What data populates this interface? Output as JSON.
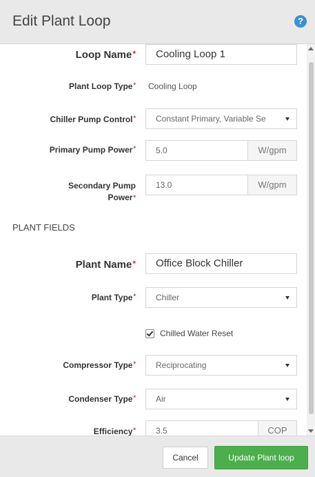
{
  "header": {
    "title": "Edit Plant Loop",
    "help_icon": "question-circle-icon"
  },
  "loop": {
    "name_label": "Loop Name",
    "name_value": "Cooling Loop 1",
    "type_label": "Plant Loop Type",
    "type_value": "Cooling Loop",
    "pump_control_label": "Chiller Pump Control",
    "pump_control_value": "Constant Primary, Variable Se",
    "primary_power_label": "Primary Pump Power",
    "primary_power_value": "5.0",
    "primary_power_unit": "W/gpm",
    "secondary_power_label_1": "Secondary Pump",
    "secondary_power_label_2": "Power",
    "secondary_power_value": "13.0",
    "secondary_power_unit": "W/gpm"
  },
  "plant": {
    "section_title": "PLANT FIELDS",
    "name_label": "Plant Name",
    "name_value": "Office Block Chiller",
    "type_label": "Plant Type",
    "type_value": "Chiller",
    "chilled_water_reset_label": "Chilled Water Reset",
    "chilled_water_reset_checked": true,
    "compressor_label": "Compressor Type",
    "compressor_value": "Reciprocating",
    "condenser_label": "Condenser Type",
    "condenser_value": "Air",
    "efficiency_label": "Efficiency",
    "efficiency_value": "3.5",
    "efficiency_unit": "COP"
  },
  "required_marker": "*",
  "footer": {
    "cancel_label": "Cancel",
    "update_label": "Update Plant loop"
  },
  "colors": {
    "primary_button": "#4cae4c",
    "required": "#d9282f",
    "help": "#3a8fd6"
  }
}
